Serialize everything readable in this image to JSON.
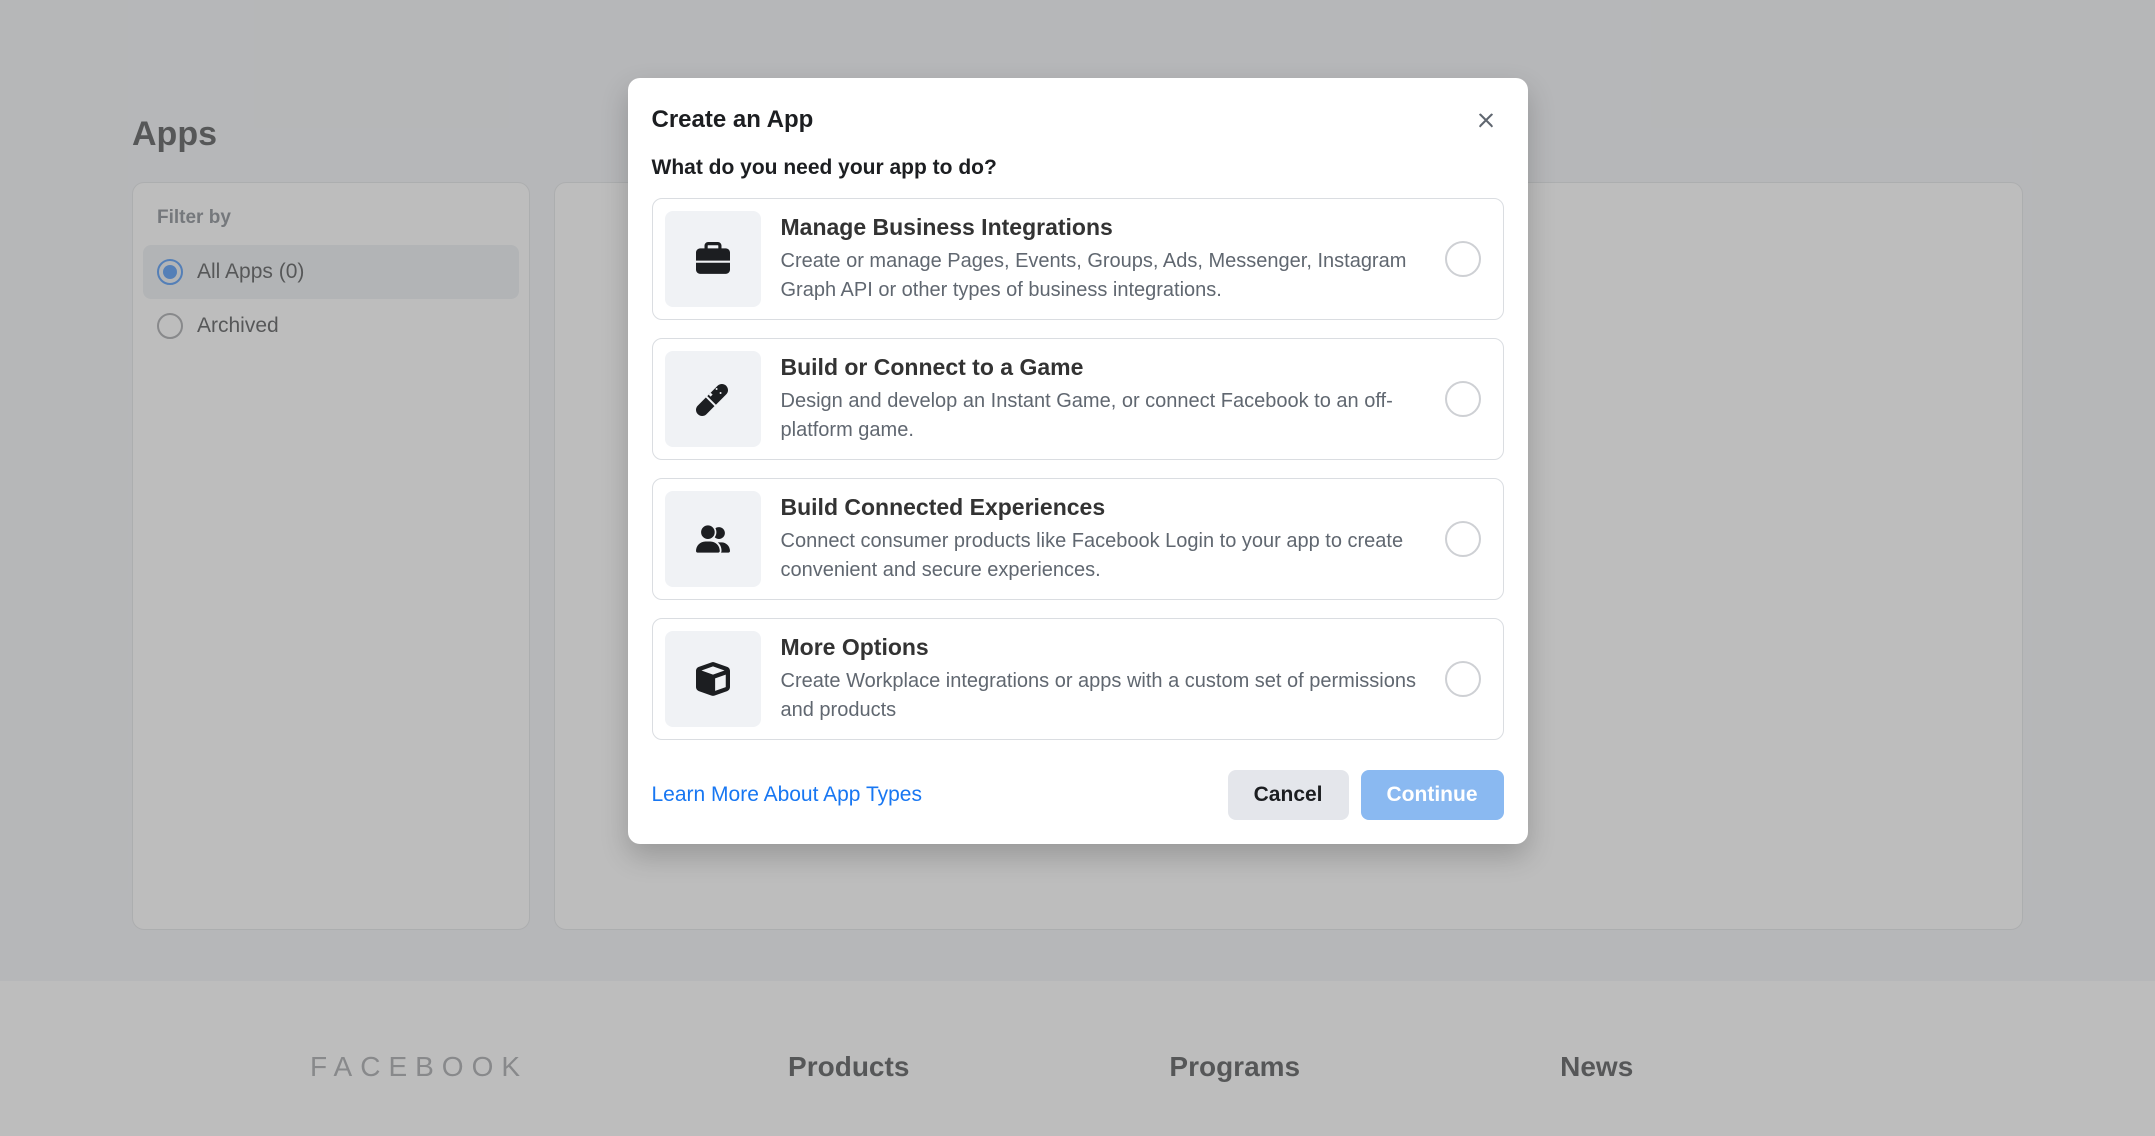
{
  "page": {
    "title": "Apps"
  },
  "sidebar": {
    "filter_label": "Filter by",
    "items": [
      {
        "label": "All Apps (0)",
        "selected": true
      },
      {
        "label": "Archived",
        "selected": false
      }
    ]
  },
  "modal": {
    "title": "Create an App",
    "subtitle": "What do you need your app to do?",
    "options": [
      {
        "icon": "briefcase-icon",
        "title": "Manage Business Integrations",
        "desc": "Create or manage Pages, Events, Groups, Ads, Messenger, Instagram Graph API or other types of business integrations."
      },
      {
        "icon": "gamepad-icon",
        "title": "Build or Connect to a Game",
        "desc": "Design and develop an Instant Game, or connect Facebook to an off-platform game."
      },
      {
        "icon": "users-icon",
        "title": "Build Connected Experiences",
        "desc": "Connect consumer products like Facebook Login to your app to create convenient and secure experiences."
      },
      {
        "icon": "cube-icon",
        "title": "More Options",
        "desc": "Create Workplace integrations or apps with a custom set of permissions and products"
      }
    ],
    "learn_more": "Learn More About App Types",
    "cancel": "Cancel",
    "continue": "Continue"
  },
  "footer": {
    "brand": "FACEBOOK",
    "cols": [
      "Products",
      "Programs",
      "News"
    ]
  }
}
